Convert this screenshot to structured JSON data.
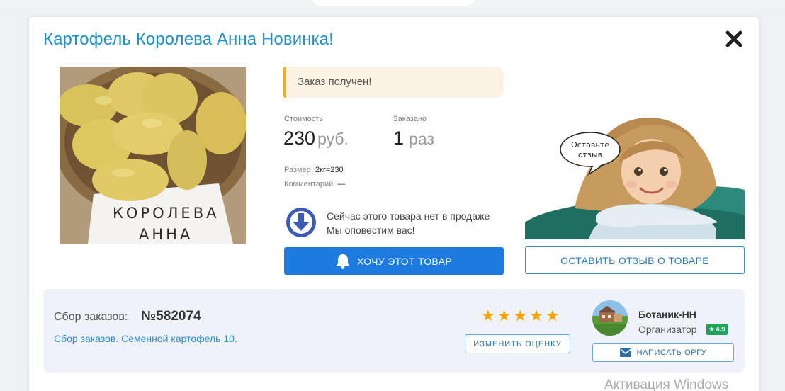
{
  "product": {
    "title": "Картофель Королева Анна Новинка!",
    "photo_sign": [
      "КОРОЛЕВА",
      "АННА"
    ]
  },
  "order": {
    "status": "Заказ получен!",
    "cost_label": "Стоимость",
    "cost_value": "230",
    "cost_unit": "руб.",
    "ordered_label": "Заказано",
    "ordered_value": "1",
    "ordered_unit": "раз",
    "size_label": "Размер:",
    "size_value": "2кг=230",
    "comment_label": "Комментарий:",
    "comment_value": "—"
  },
  "availability": {
    "line1": "Сейчас этого товара нет в продаже",
    "line2": "Мы оповестим вас!",
    "want_button": "ХОЧУ ЭТОТ ТОВАР"
  },
  "review": {
    "bubble_line1": "Оставьте",
    "bubble_line2": "отзыв",
    "button": "ОСТАВИТЬ ОТЗЫВ О ТОВАРЕ"
  },
  "collection": {
    "label": "Сбор заказов:",
    "number": "№582074",
    "link": "Сбор заказов. Семенной картофель 10.",
    "stars": 5,
    "change_rating_button": "ИЗМЕНИТЬ ОЦЕНКУ"
  },
  "organizer": {
    "name": "Ботаник-НН",
    "role": "Организатор",
    "rating": "4.9",
    "write_button": "НАПИСАТЬ ОРГУ"
  },
  "system": {
    "watermark": "Активация Windows"
  },
  "colors": {
    "title": "#2190c4",
    "primary_button": "#1d7be0",
    "status_accent": "#f5a623",
    "star": "#f5a400",
    "rating_badge": "#20a35a"
  }
}
